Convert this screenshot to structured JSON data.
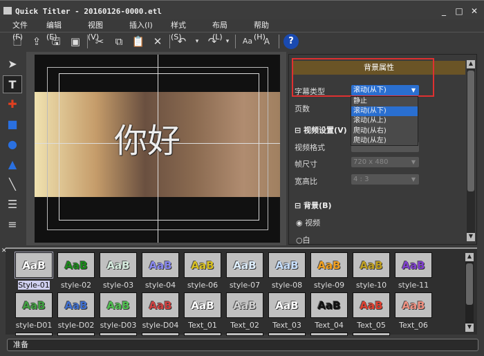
{
  "window": {
    "title": "Quick Titler - 20160126-0000.etl",
    "min": "_",
    "max": "□",
    "close": "✕"
  },
  "menu": [
    "文件(F)",
    "编辑(E)",
    "视图(V)",
    "插入(I)",
    "样式(S)",
    "布局(L)",
    "帮助(H)"
  ],
  "preview": {
    "text": "你好"
  },
  "panel": {
    "header": "背景属性",
    "subtitle_type_label": "字幕类型",
    "subtitle_type_value": "滚动(从下)",
    "options": [
      "静止",
      "滚动(从下)",
      "滚动(从上)",
      "爬动(从右)",
      "爬动(从左)"
    ],
    "selected_option": 1,
    "pages_label": "页数",
    "video_section": "视频设置(V)",
    "video_format_label": "视频格式",
    "frame_size_label": "帧尺寸",
    "frame_size_value": "720 x 480",
    "aspect_label": "宽高比",
    "aspect_value": "4 : 3",
    "bg_section": "背景(B)",
    "radio_video": "视频",
    "radio_white": "白"
  },
  "styles": [
    {
      "name": "Style-01",
      "color": "#ffffff"
    },
    {
      "name": "style-02",
      "color": "#1a8a1a"
    },
    {
      "name": "style-03",
      "color": "#d8eee0"
    },
    {
      "name": "style-04",
      "color": "#8888ee"
    },
    {
      "name": "style-06",
      "color": "#d8c020"
    },
    {
      "name": "style-07",
      "color": "#e0f0ff"
    },
    {
      "name": "style-08",
      "color": "#c8e0ff"
    },
    {
      "name": "style-09",
      "color": "#f0a020"
    },
    {
      "name": "style-10",
      "color": "#c0a020"
    },
    {
      "name": "style-11",
      "color": "#8040d0"
    },
    {
      "name": "style-D01",
      "color": "#40a040"
    },
    {
      "name": "style-D02",
      "color": "#4070d0"
    },
    {
      "name": "style-D03",
      "color": "#50c050"
    },
    {
      "name": "style-D04",
      "color": "#d04040"
    },
    {
      "name": "Text_01",
      "color": "#ffffff"
    },
    {
      "name": "Text_02",
      "color": "#d0d0d0"
    },
    {
      "name": "Text_03",
      "color": "#ffffff"
    },
    {
      "name": "Text_04",
      "color": "#111111"
    },
    {
      "name": "Text_05",
      "color": "#e04030"
    },
    {
      "name": "Text_06",
      "color": "#f09080"
    }
  ],
  "style_sample": "AaB",
  "status": "准备"
}
